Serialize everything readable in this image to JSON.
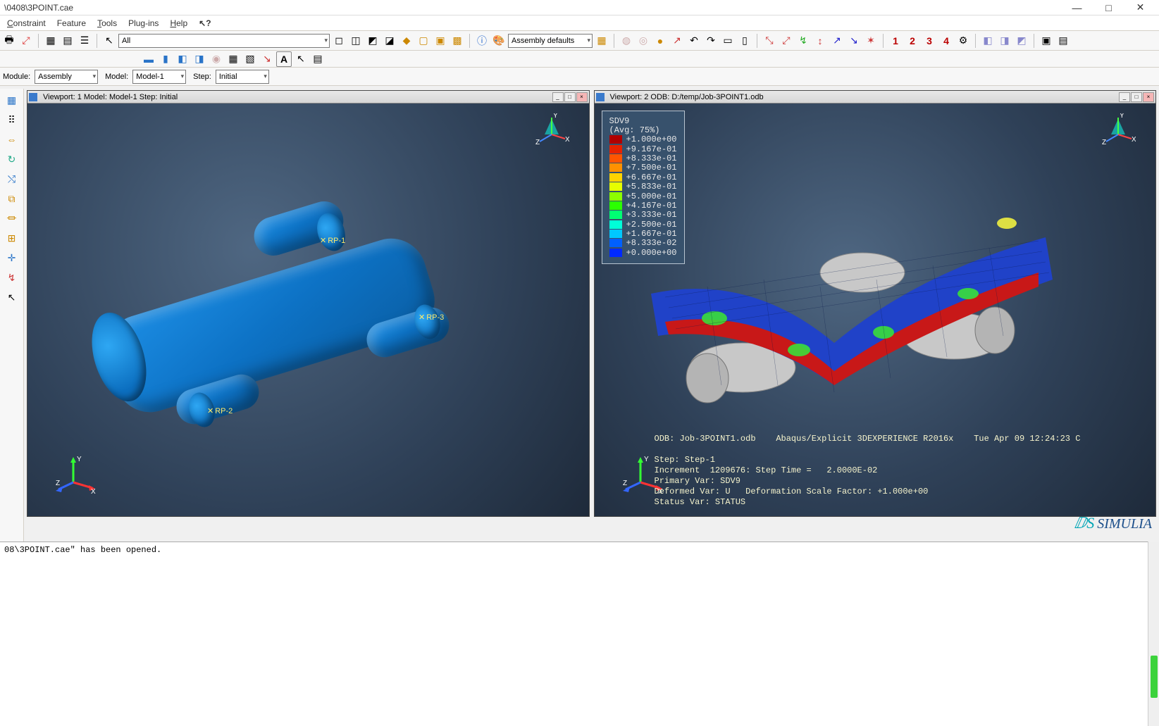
{
  "window": {
    "title": "\\0408\\3POINT.cae",
    "min": "—",
    "max": "□",
    "close": "✕"
  },
  "menu": {
    "constraint": "Constraint",
    "feature": "Feature",
    "tools": "Tools",
    "plugins": "Plug-ins",
    "help": "Help",
    "whats": "?"
  },
  "toolbar1": {
    "select_filter": "All",
    "render_combo": "Assembly defaults",
    "num1": "1",
    "num2": "2",
    "num3": "3",
    "num4": "4"
  },
  "context": {
    "module_label": "Module:",
    "module_value": "Assembly",
    "model_label": "Model:",
    "model_value": "Model-1",
    "step_label": "Step:",
    "step_value": "Initial"
  },
  "viewport1": {
    "title": "Viewport: 1     Model: Model-1     Step: Initial",
    "rp1": "RP-1",
    "rp2": "RP-2",
    "rp3": "RP-3"
  },
  "viewport2": {
    "title": "Viewport: 2     ODB: D:/temp/Job-3POINT1.odb",
    "legend": {
      "var": "SDV9",
      "avg": "(Avg: 75%)",
      "vals": [
        "+1.000e+00",
        "+9.167e-01",
        "+8.333e-01",
        "+7.500e-01",
        "+6.667e-01",
        "+5.833e-01",
        "+5.000e-01",
        "+4.167e-01",
        "+3.333e-01",
        "+2.500e-01",
        "+1.667e-01",
        "+8.333e-02",
        "+0.000e+00"
      ],
      "colors": [
        "#b10000",
        "#e62200",
        "#ff5500",
        "#ff9100",
        "#ffd400",
        "#e6ff00",
        "#8cff00",
        "#2bff00",
        "#00ff73",
        "#00ffd8",
        "#00c8ff",
        "#0060ff",
        "#0029ff"
      ]
    },
    "info": {
      "line1": "ODB: Job-3POINT1.odb    Abaqus/Explicit 3DEXPERIENCE R2016x    Tue Apr 09 12:24:23 C",
      "line2": "Step: Step-1",
      "line3": "Increment  1209676: Step Time =   2.0000E-02",
      "line4": "Primary Var: SDV9",
      "line5": "Deformed Var: U   Deformation Scale Factor: +1.000e+00",
      "line6": "Status Var: STATUS"
    }
  },
  "brand": "SIMULIA",
  "message": "08\\3POINT.cae\" has been opened.",
  "axes": {
    "x": "X",
    "y": "Y",
    "z": "Z"
  }
}
